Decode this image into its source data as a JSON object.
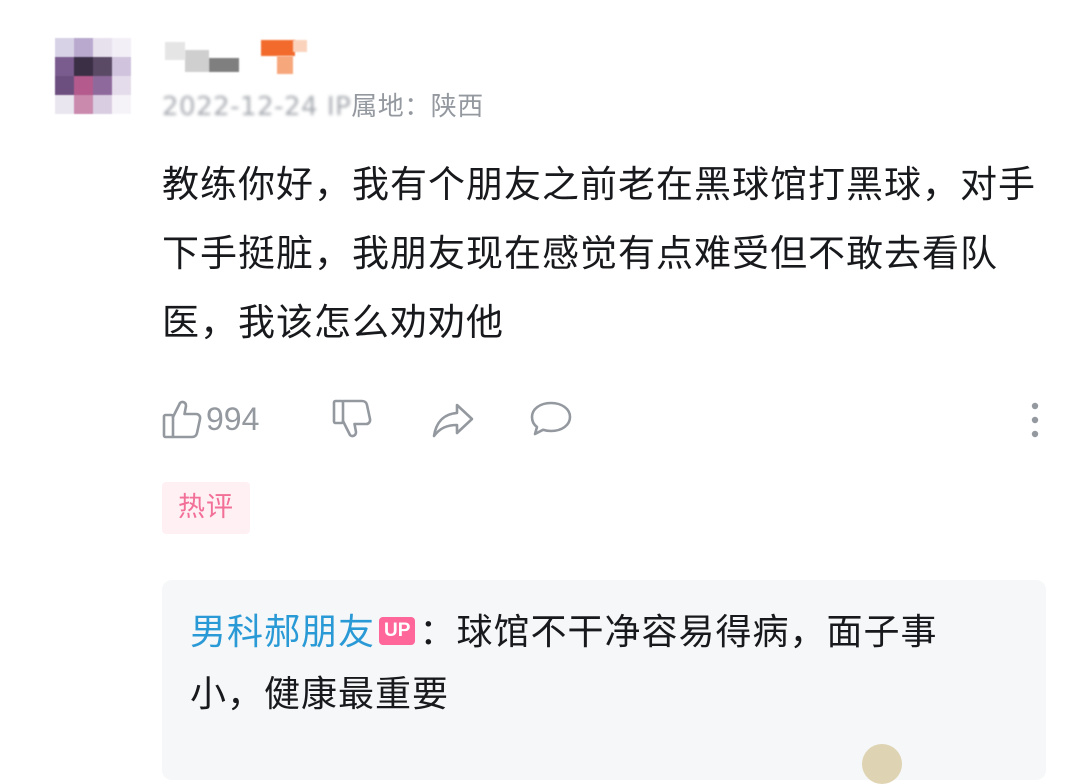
{
  "comment": {
    "user": {
      "avatar_icon": "pixelated-avatar-icon",
      "name_icon": "pixelated-username-icon",
      "accent_color": "#f26b2d"
    },
    "meta": {
      "date": "2022-12-24",
      "ip_prefix": "IP",
      "location_label": "属地：陕西"
    },
    "text": "教练你好，我有个朋友之前老在黑球馆打黑球，对手下手挺脏，我朋友现在感觉有点难受但不敢去看队医，我该怎么劝劝他",
    "actions": {
      "like_icon": "thumbs-up-icon",
      "like_count": "994",
      "dislike_icon": "thumbs-down-icon",
      "share_icon": "share-icon",
      "reply_icon": "comment-bubble-icon",
      "more_icon": "more-vertical-icon"
    },
    "badge": "热评"
  },
  "reply": {
    "author": "男科郝朋友",
    "up_label": "UP",
    "separator": "：",
    "text": "球馆不干净容易得病，面子事小，健康最重要"
  },
  "colors": {
    "reply_author": "#2a9ad6",
    "up_badge": "#ff6699",
    "hot_badge_text": "#f26f98",
    "hot_badge_bg": "#fff0f4",
    "meta_text": "#9499a0",
    "reply_bg": "#f6f7f8"
  }
}
